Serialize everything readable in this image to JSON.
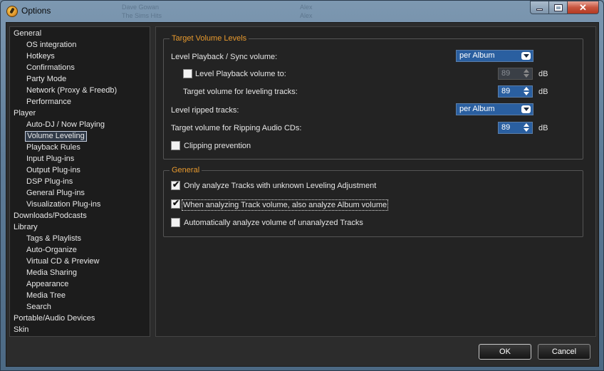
{
  "window": {
    "title": "Options",
    "ghost_left": "Dave Gowan",
    "ghost_right": "Alex",
    "ghost_left2": "The Sims Hits",
    "ghost_right2": "Alex"
  },
  "tree": [
    {
      "label": "General",
      "level": 0
    },
    {
      "label": "OS integration",
      "level": 1
    },
    {
      "label": "Hotkeys",
      "level": 1
    },
    {
      "label": "Confirmations",
      "level": 1
    },
    {
      "label": "Party Mode",
      "level": 1
    },
    {
      "label": "Network (Proxy & Freedb)",
      "level": 1
    },
    {
      "label": "Performance",
      "level": 1
    },
    {
      "label": "Player",
      "level": 0
    },
    {
      "label": "Auto-DJ / Now Playing",
      "level": 1
    },
    {
      "label": "Volume Leveling",
      "level": 1,
      "selected": true
    },
    {
      "label": "Playback Rules",
      "level": 1
    },
    {
      "label": "Input Plug-ins",
      "level": 1
    },
    {
      "label": "Output Plug-ins",
      "level": 1
    },
    {
      "label": "DSP Plug-ins",
      "level": 1
    },
    {
      "label": "General Plug-ins",
      "level": 1
    },
    {
      "label": "Visualization Plug-ins",
      "level": 1
    },
    {
      "label": "Downloads/Podcasts",
      "level": 0
    },
    {
      "label": "Library",
      "level": 0
    },
    {
      "label": "Tags & Playlists",
      "level": 1
    },
    {
      "label": "Auto-Organize",
      "level": 1
    },
    {
      "label": "Virtual CD & Preview",
      "level": 1
    },
    {
      "label": "Media Sharing",
      "level": 1
    },
    {
      "label": "Appearance",
      "level": 1
    },
    {
      "label": "Media Tree",
      "level": 1
    },
    {
      "label": "Search",
      "level": 1
    },
    {
      "label": "Portable/Audio Devices",
      "level": 0
    },
    {
      "label": "Skin",
      "level": 0
    }
  ],
  "target_group": {
    "title": "Target Volume Levels",
    "level_playback_label": "Level Playback / Sync volume:",
    "level_playback_value": "per Album",
    "level_playback_to_label": "Level Playback volume to:",
    "level_playback_to_checked": false,
    "level_playback_to_value": "89",
    "target_leveling_label": "Target volume for leveling tracks:",
    "target_leveling_value": "89",
    "level_ripped_label": "Level ripped tracks:",
    "level_ripped_value": "per Album",
    "target_ripping_label": "Target volume for Ripping Audio CDs:",
    "target_ripping_value": "89",
    "unit": "dB",
    "clipping_label": "Clipping prevention",
    "clipping_checked": false
  },
  "general_group": {
    "title": "General",
    "opt1_label": "Only analyze Tracks with unknown Leveling Adjustment",
    "opt1_checked": true,
    "opt2_label": "When analyzing Track volume, also analyze Album volume",
    "opt2_checked": true,
    "opt3_label": "Automatically analyze volume of unanalyzed Tracks",
    "opt3_checked": false
  },
  "buttons": {
    "ok": "OK",
    "cancel": "Cancel"
  },
  "colors": {
    "accent": "#e89a2e",
    "select_blue": "#2a5fa0",
    "background": "#232323"
  }
}
